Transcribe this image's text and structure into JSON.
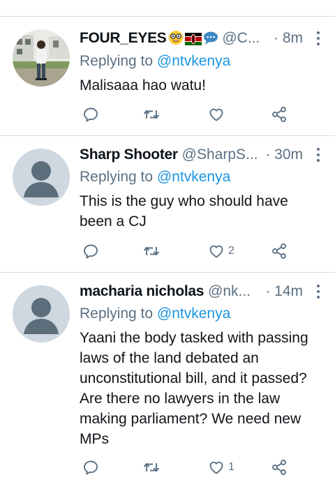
{
  "tweets": [
    {
      "name": "FOUR_EYES",
      "handle": "@C...",
      "time": "· 8m",
      "reply_prefix": "Replying to",
      "reply_to": "@ntvkenya",
      "text": "Malisaaa hao watu!",
      "likes": "",
      "avatar": "photo",
      "emojis": [
        "nerd-face-emoji",
        "kenya-flag-emoji",
        "speech-bubble-emoji"
      ]
    },
    {
      "name": "Sharp Shooter",
      "handle": "@SharpS...",
      "time": "· 30m",
      "reply_prefix": "Replying to",
      "reply_to": "@ntvkenya",
      "text": "This is the guy who should have been a CJ",
      "likes": "2",
      "avatar": "default"
    },
    {
      "name": "macharia nicholas",
      "handle": "@nk...",
      "time": "· 14m",
      "reply_prefix": "Replying to",
      "reply_to": "@ntvkenya",
      "text": "Yaani the body tasked with passing laws of the land debated an unconstitutional bill, and it passed? Are there no lawyers in the law making parliament? We need new MPs",
      "likes": "1",
      "avatar": "default"
    }
  ],
  "colors": {
    "secondary": "#5b7083",
    "accent": "#1b95e0",
    "divider": "#d9dee2"
  },
  "icons": [
    "reply-icon",
    "retweet-icon",
    "like-icon",
    "share-icon",
    "more-icon"
  ]
}
